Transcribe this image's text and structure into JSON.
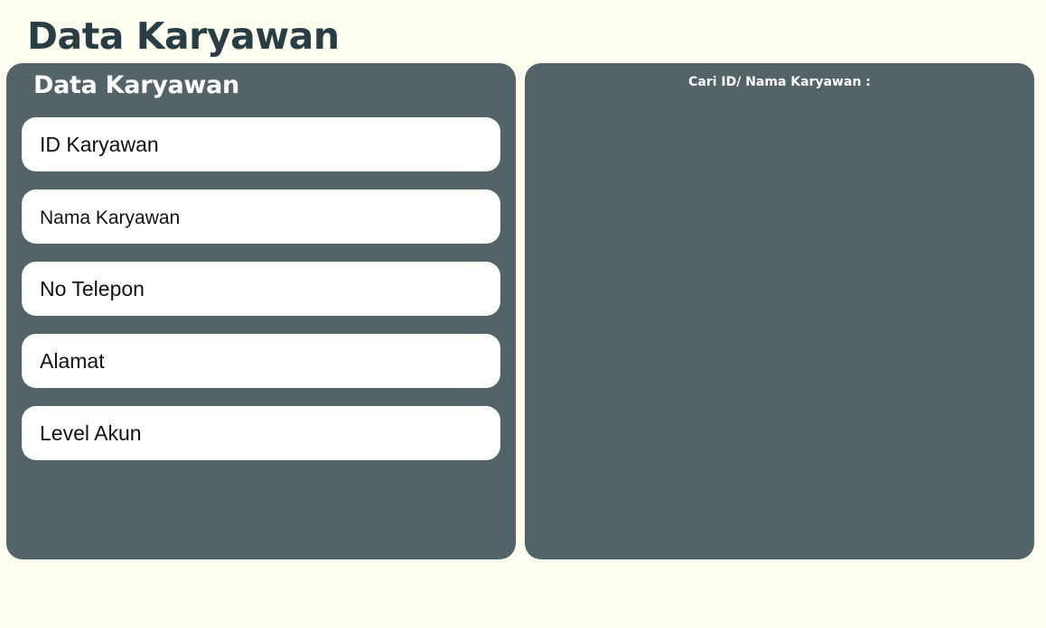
{
  "header": {
    "title": "Data Karyawan"
  },
  "form_panel": {
    "title": "Data Karyawan",
    "fields": [
      {
        "placeholder": "ID Karyawan",
        "value": ""
      },
      {
        "placeholder": "Nama Karyawan",
        "value": ""
      },
      {
        "placeholder": "No Telepon",
        "value": ""
      },
      {
        "placeholder": "Alamat",
        "value": ""
      },
      {
        "placeholder": "Level Akun",
        "value": ""
      }
    ]
  },
  "search_panel": {
    "label": "Cari ID/ Nama Karyawan :"
  },
  "colors": {
    "background": "#fefff1",
    "panel": "#536468",
    "title_text": "#283e44",
    "field_background": "#ffffff"
  }
}
